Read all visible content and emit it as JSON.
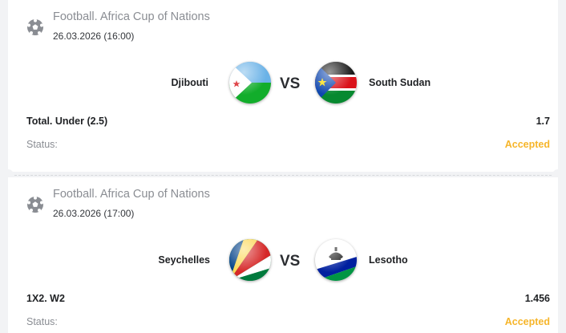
{
  "colors": {
    "accepted": "#f6b52a",
    "muted_text": "#8a8d93",
    "primary_text": "#1f2124"
  },
  "bets": [
    {
      "sport_icon": "soccer-ball-icon",
      "league": "Football. Africa Cup of Nations",
      "datetime": "26.03.2026 (16:00)",
      "team1": "Djibouti",
      "team1_flag": "djibouti-flag-icon",
      "vs": "VS",
      "team2": "South Sudan",
      "team2_flag": "south-sudan-flag-icon",
      "bet_type": "Total. Under (2.5)",
      "odd": "1.7",
      "status_label": "Status:",
      "status_value": "Accepted"
    },
    {
      "sport_icon": "soccer-ball-icon",
      "league": "Football. Africa Cup of Nations",
      "datetime": "26.03.2026 (17:00)",
      "team1": "Seychelles",
      "team1_flag": "seychelles-flag-icon",
      "vs": "VS",
      "team2": "Lesotho",
      "team2_flag": "lesotho-flag-icon",
      "bet_type": "1X2. W2",
      "odd": "1.456",
      "status_label": "Status:",
      "status_value": "Accepted"
    }
  ]
}
